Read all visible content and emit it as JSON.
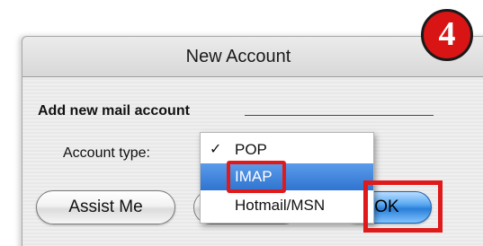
{
  "dialog": {
    "title": "New Account",
    "section_label": "Add new mail account",
    "account_type_label": "Account type:",
    "assist_button_label": "Assist Me",
    "ok_button_label": "OK"
  },
  "account_type_menu": {
    "items": [
      {
        "label": "POP",
        "checked": true,
        "highlighted": false
      },
      {
        "label": "IMAP",
        "checked": false,
        "highlighted": true
      },
      {
        "label": "Hotmail/MSN",
        "checked": false,
        "highlighted": false
      }
    ],
    "check_glyph": "✓"
  },
  "annotation": {
    "step_number": "4",
    "highlight_color": "#e01a1a"
  },
  "colors": {
    "selection_blue": "#3a7fd6",
    "ok_button_blue": "#2a7fd8",
    "badge_red": "#d81414"
  }
}
